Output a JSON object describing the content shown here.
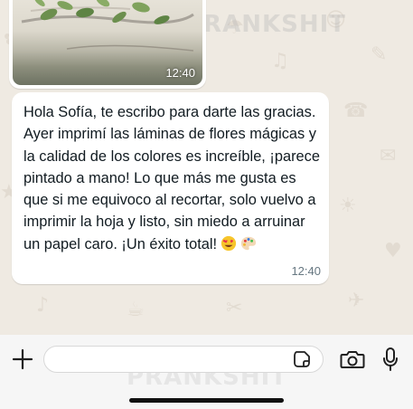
{
  "image_message": {
    "time": "12:40"
  },
  "text_message": {
    "text": "Hola Sofía, te escribo para darte las gracias. Ayer imprimí las láminas de flores mágicas y la calidad de los colores es increíble, ¡parece pintado a mano! Lo que más me gusta es que si me equivoco al recortar, solo vuelvo a imprimir la hoja y listo, sin miedo a arruinar un papel caro. ¡Un éxito total!",
    "emojis": [
      "heart-eyes-emoji",
      "palette-emoji"
    ],
    "time": "12:40"
  },
  "watermark": {
    "text": "PRANKSHIT"
  },
  "composer": {
    "placeholder": "",
    "icons": [
      "plus-icon",
      "sticker-icon",
      "camera-icon",
      "mic-icon"
    ]
  },
  "colors": {
    "chat_background": "#efeae2",
    "bubble": "#ffffff",
    "text": "#111b21",
    "timestamp": "#667781",
    "bottom_bar": "#f6f6f6"
  }
}
